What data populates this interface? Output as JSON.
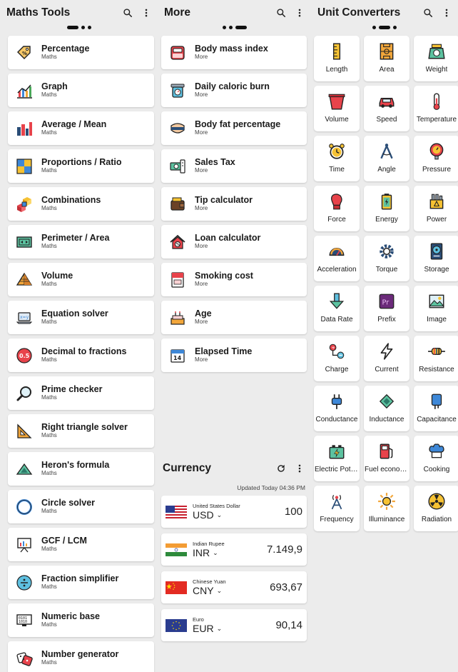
{
  "maths": {
    "title": "Maths Tools",
    "items": [
      {
        "title": "Percentage",
        "sub": "Maths",
        "icon": "percentage-tag-icon"
      },
      {
        "title": "Graph",
        "sub": "Maths",
        "icon": "graph-chart-icon"
      },
      {
        "title": "Average / Mean",
        "sub": "Maths",
        "icon": "bar-chart-icon"
      },
      {
        "title": "Proportions / Ratio",
        "sub": "Maths",
        "icon": "squares-grid-icon"
      },
      {
        "title": "Combinations",
        "sub": "Maths",
        "icon": "cubes-icon"
      },
      {
        "title": "Perimeter / Area",
        "sub": "Maths",
        "icon": "perimeter-icon"
      },
      {
        "title": "Volume",
        "sub": "Maths",
        "icon": "pyramid-icon"
      },
      {
        "title": "Equation solver",
        "sub": "Maths",
        "icon": "laptop-equation-icon"
      },
      {
        "title": "Decimal to fractions",
        "sub": "Maths",
        "icon": "decimal-badge-icon"
      },
      {
        "title": "Prime checker",
        "sub": "Maths",
        "icon": "magnifier-icon"
      },
      {
        "title": "Right triangle solver",
        "sub": "Maths",
        "icon": "set-square-icon"
      },
      {
        "title": "Heron's formula",
        "sub": "Maths",
        "icon": "triangle-icon"
      },
      {
        "title": "Circle solver",
        "sub": "Maths",
        "icon": "circle-icon"
      },
      {
        "title": "GCF / LCM",
        "sub": "Maths",
        "icon": "presentation-board-icon"
      },
      {
        "title": "Fraction simplifier",
        "sub": "Maths",
        "icon": "fraction-icon"
      },
      {
        "title": "Numeric base",
        "sub": "Maths",
        "icon": "binary-monitor-icon"
      },
      {
        "title": "Number generator",
        "sub": "Maths",
        "icon": "dice-icon"
      }
    ]
  },
  "more": {
    "title": "More",
    "items": [
      {
        "title": "Body mass index",
        "sub": "More",
        "icon": "bathroom-scale-icon"
      },
      {
        "title": "Daily caloric burn",
        "sub": "More",
        "icon": "kitchen-scale-icon"
      },
      {
        "title": "Body fat percentage",
        "sub": "More",
        "icon": "body-fat-icon"
      },
      {
        "title": "Sales Tax",
        "sub": "More",
        "icon": "money-tax-icon"
      },
      {
        "title": "Tip calculator",
        "sub": "More",
        "icon": "wallet-icon"
      },
      {
        "title": "Loan calculator",
        "sub": "More",
        "icon": "house-loan-icon"
      },
      {
        "title": "Smoking cost",
        "sub": "More",
        "icon": "cigarette-pack-icon"
      },
      {
        "title": "Age",
        "sub": "More",
        "icon": "birthday-cake-icon"
      },
      {
        "title": "Elapsed Time",
        "sub": "More",
        "icon": "calendar-icon"
      }
    ]
  },
  "currency": {
    "title": "Currency",
    "updated": "Updated Today 04:36 PM",
    "rows": [
      {
        "name": "United States Dollar",
        "code": "USD",
        "value": "100",
        "flag": "us-flag-icon"
      },
      {
        "name": "Indian Rupee",
        "code": "INR",
        "value": "7.149,9",
        "flag": "india-flag-icon"
      },
      {
        "name": "Chinese Yuan",
        "code": "CNY",
        "value": "693,67",
        "flag": "china-flag-icon"
      },
      {
        "name": "Euro",
        "code": "EUR",
        "value": "90,14",
        "flag": "eu-flag-icon"
      }
    ]
  },
  "units": {
    "title": "Unit Converters",
    "items": [
      {
        "label": "Length",
        "icon": "ruler-icon"
      },
      {
        "label": "Area",
        "icon": "field-area-icon"
      },
      {
        "label": "Weight",
        "icon": "weight-scale-icon"
      },
      {
        "label": "Volume",
        "icon": "bucket-icon"
      },
      {
        "label": "Speed",
        "icon": "car-icon"
      },
      {
        "label": "Temperature",
        "icon": "thermometer-icon"
      },
      {
        "label": "Time",
        "icon": "alarm-clock-icon"
      },
      {
        "label": "Angle",
        "icon": "compass-icon"
      },
      {
        "label": "Pressure",
        "icon": "pressure-gauge-icon"
      },
      {
        "label": "Force",
        "icon": "boxing-glove-icon"
      },
      {
        "label": "Energy",
        "icon": "battery-icon"
      },
      {
        "label": "Power",
        "icon": "power-station-icon"
      },
      {
        "label": "Acceleration",
        "icon": "speedometer-icon"
      },
      {
        "label": "Torque",
        "icon": "gear-icon"
      },
      {
        "label": "Storage",
        "icon": "hard-drive-icon"
      },
      {
        "label": "Data Rate",
        "icon": "download-arrow-icon"
      },
      {
        "label": "Prefix",
        "icon": "prefix-badge-icon"
      },
      {
        "label": "Image",
        "icon": "picture-icon"
      },
      {
        "label": "Charge",
        "icon": "charge-icon"
      },
      {
        "label": "Current",
        "icon": "lightning-icon"
      },
      {
        "label": "Resistance",
        "icon": "resistor-icon"
      },
      {
        "label": "Conductance",
        "icon": "plug-icon"
      },
      {
        "label": "Inductance",
        "icon": "microchip-icon"
      },
      {
        "label": "Capacitance",
        "icon": "capacitor-icon"
      },
      {
        "label": "Electric Potential",
        "icon": "car-battery-icon"
      },
      {
        "label": "Fuel economy",
        "icon": "fuel-pump-icon"
      },
      {
        "label": "Cooking",
        "icon": "chef-hat-icon"
      },
      {
        "label": "Frequency",
        "icon": "radio-tower-icon"
      },
      {
        "label": "Illuminance",
        "icon": "sun-icon"
      },
      {
        "label": "Radiation",
        "icon": "radiation-icon"
      }
    ]
  }
}
